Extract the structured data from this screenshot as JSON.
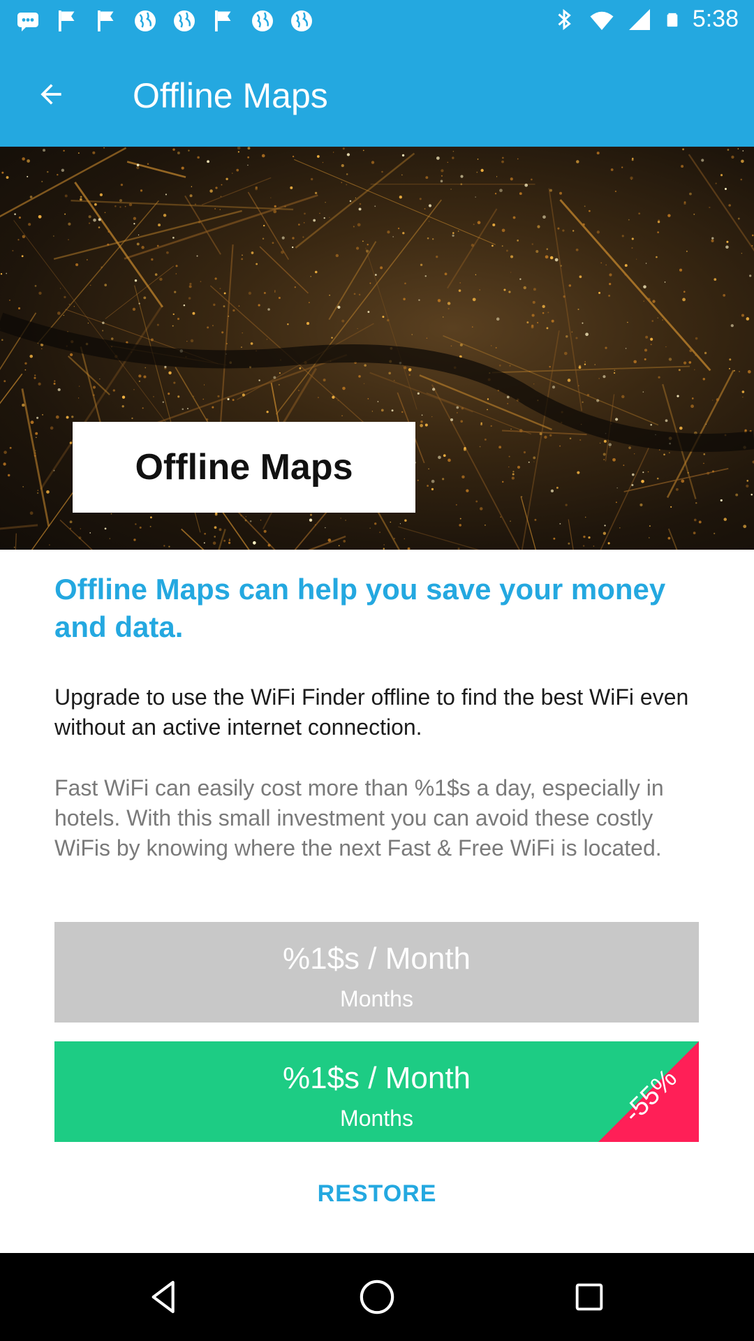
{
  "status_bar": {
    "time": "5:38",
    "icons": [
      "message-icon",
      "flag-icon",
      "flag-icon",
      "globe-icon",
      "globe-icon",
      "flag-icon",
      "globe-icon",
      "globe-icon",
      "bluetooth-icon",
      "wifi-icon",
      "signal-icon",
      "battery-icon"
    ]
  },
  "app_bar": {
    "title": "Offline Maps",
    "back_icon": "arrow-back-icon"
  },
  "hero": {
    "label": "Offline Maps"
  },
  "content": {
    "headline": "Offline Maps can help you save your money and data.",
    "paragraph_1": "Upgrade to use the WiFi Finder offline to find the best WiFi even without an active internet connection.",
    "paragraph_2": "Fast WiFi can easily cost more than %1$s a day, especially in hotels. With this small investment you can avoid these costly WiFis by knowing where the next Fast & Free WiFi is located."
  },
  "plans": [
    {
      "price": "%1$s / Month",
      "period": "Months",
      "color": "#c8c8c8"
    },
    {
      "price": "%1$s / Month",
      "period": "Months",
      "color": "#1dcc84",
      "badge": "-55%",
      "badge_color": "#ff1f57"
    }
  ],
  "restore_label": "RESTORE",
  "colors": {
    "accent": "#24a8e0",
    "green": "#1dcc84",
    "discount": "#ff1f57"
  },
  "nav_bar": {
    "buttons": [
      "back-triangle-icon",
      "home-circle-icon",
      "recents-square-icon"
    ]
  }
}
